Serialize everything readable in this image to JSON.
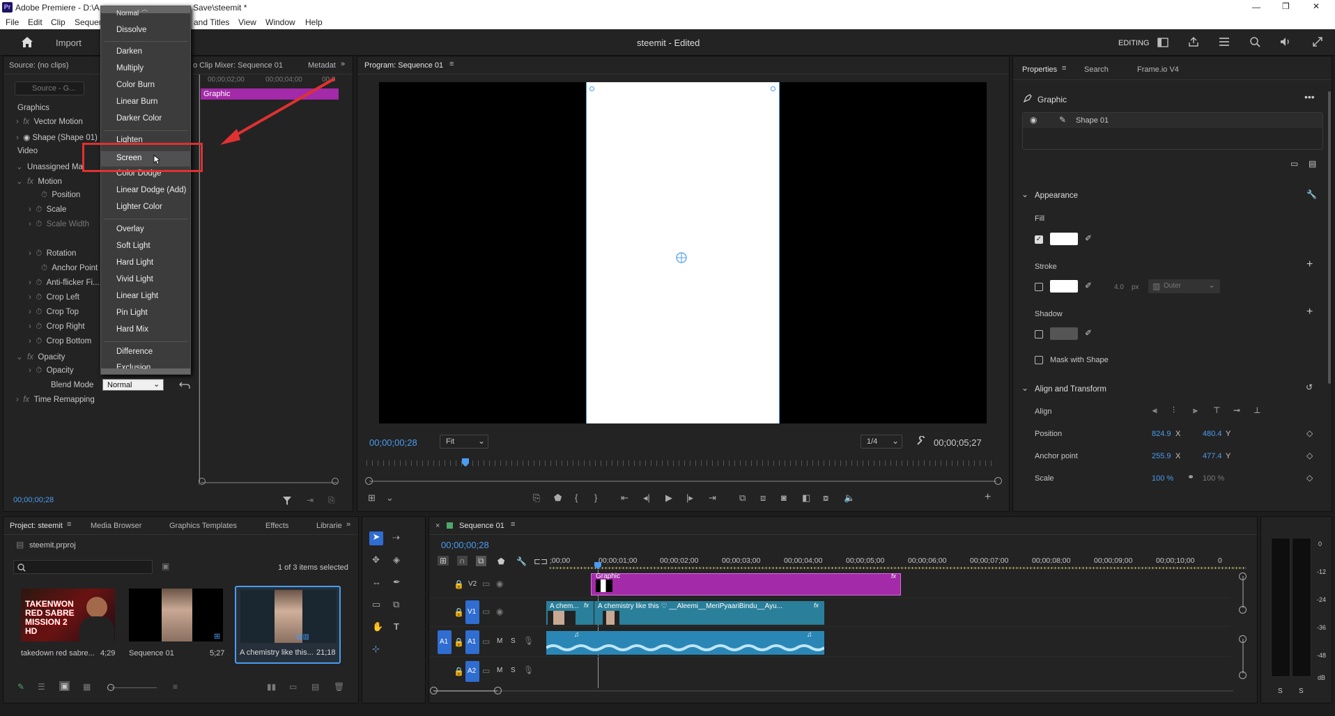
{
  "window": {
    "title": "Adobe Premiere - D:\\A",
    "title_tail": "Save\\steemit *",
    "app_badge": "Pr",
    "controls": {
      "minimize": "—",
      "maximize": "❐",
      "close": "✕"
    }
  },
  "menu": {
    "items": [
      "File",
      "Edit",
      "Clip",
      "Sequence",
      "and Titles",
      "View",
      "Window",
      "Help"
    ]
  },
  "header": {
    "import_label": "Import",
    "project_title": "steemit - Edited",
    "workspace": "EDITING"
  },
  "source_panel": {
    "tab_source": "Source: (no clips)",
    "tab_mixer": "o Clip Mixer: Sequence 01",
    "tab_metadata": "Metadat",
    "search_placeholder": "Source - G...",
    "ruler": [
      "00;00;02;00",
      "00;00;04;00",
      "00;0"
    ],
    "graphic_bar_label": "Graphic",
    "rows": {
      "graphics": "Graphics",
      "vector_motion": "Vector Motion",
      "shape": "Shape (Shape 01)",
      "video": "Video",
      "unassigned_masks": "Unassigned Ma",
      "motion": "Motion",
      "position": "Position",
      "scale": "Scale",
      "scale_width": "Scale Width",
      "rotation": "Rotation",
      "anchor_point": "Anchor Point",
      "anti_flicker": "Anti-flicker Fi...",
      "crop_left": "Crop Left",
      "crop_top": "Crop Top",
      "crop_right": "Crop Right",
      "crop_bottom": "Crop Bottom",
      "opacity_group": "Opacity",
      "opacity": "Opacity",
      "blend_mode": "Blend Mode",
      "blend_value": "Normal",
      "time_remapping": "Time Remapping"
    },
    "timecode": "00;00;00;28"
  },
  "blend_menu": {
    "top_partial": "Normal",
    "groups": [
      [
        "Dissolve"
      ],
      [
        "Darken",
        "Multiply",
        "Color Burn",
        "Linear Burn",
        "Darker Color"
      ],
      [
        "Lighten",
        "Screen",
        "Color Dodge",
        "Linear Dodge (Add)",
        "Lighter Color"
      ],
      [
        "Overlay",
        "Soft Light",
        "Hard Light",
        "Vivid Light",
        "Linear Light",
        "Pin Light",
        "Hard Mix"
      ],
      [
        "Difference",
        "Exclusion"
      ]
    ],
    "highlighted": "Screen"
  },
  "program": {
    "tab": "Program: Sequence 01",
    "timecode_left": "00;00;00;28",
    "fit": "Fit",
    "resolution": "1/4",
    "timecode_right": "00;00;05;27"
  },
  "properties": {
    "tabs": [
      "Properties",
      "Search",
      "Frame.io V4"
    ],
    "graphic": "Graphic",
    "layer": "Shape 01",
    "appearance": "Appearance",
    "fill": "Fill",
    "stroke": "Stroke",
    "stroke_width": "4.0",
    "stroke_unit": "px",
    "stroke_type": "Outer",
    "shadow": "Shadow",
    "mask_with_shape": "Mask with Shape",
    "align_transform": "Align and Transform",
    "align": "Align",
    "position_label": "Position",
    "position_x": "824.9",
    "position_y": "480.4",
    "anchor_label": "Anchor point",
    "anchor_x": "255.9",
    "anchor_y": "477.4",
    "scale_label": "Scale",
    "scale_x": "100 %",
    "scale_y": "100 %",
    "x": "X",
    "y": "Y"
  },
  "project": {
    "tabs": [
      "Project: steemit",
      "Media Browser",
      "Graphics Templates",
      "Effects",
      "Librarie"
    ],
    "file": "steemit.prproj",
    "selection": "1 of 3 items selected",
    "items": [
      {
        "name": "takedown red sabre...",
        "duration": "4;29",
        "thumb_text": "TAKENWON RED SABRE MISSION 2 HD"
      },
      {
        "name": "Sequence 01",
        "duration": "5;27"
      },
      {
        "name": "A chemistry like this...",
        "duration": "21;18"
      }
    ]
  },
  "timeline": {
    "tab": "Sequence 01",
    "timecode": "00;00;00;28",
    "ruler": [
      ";00;00",
      "00;00;01;00",
      "00;00;02;00",
      "00;00;03;00",
      "00;00;04;00",
      "00;00;05;00",
      "00;00;06;00",
      "00;00;07;00",
      "00;00;08;00",
      "00;00;09;00",
      "00;00;10;00",
      "0"
    ],
    "tracks": {
      "v2": "V2",
      "v1": "V1",
      "a1": "A1",
      "a2": "A2",
      "m": "M",
      "s": "S"
    },
    "clips": {
      "graphic": "Graphic",
      "v1_short": "A chem...",
      "v1_long": "A chemistry like this ♡ __Aleemi__MeriPyaariBindu__Ayu...",
      "fx": "fx"
    }
  },
  "meter": {
    "ticks": [
      "0",
      "-12",
      "-24",
      "-36",
      "-48",
      "dB"
    ],
    "solo": [
      "S",
      "S"
    ]
  },
  "colors": {
    "accent": "#4a9cf0",
    "graphic_clip": "#a32aa8",
    "video_clip": "#2a7f9a",
    "audio_clip": "#2a87b5",
    "highlight_box": "#e03131"
  }
}
